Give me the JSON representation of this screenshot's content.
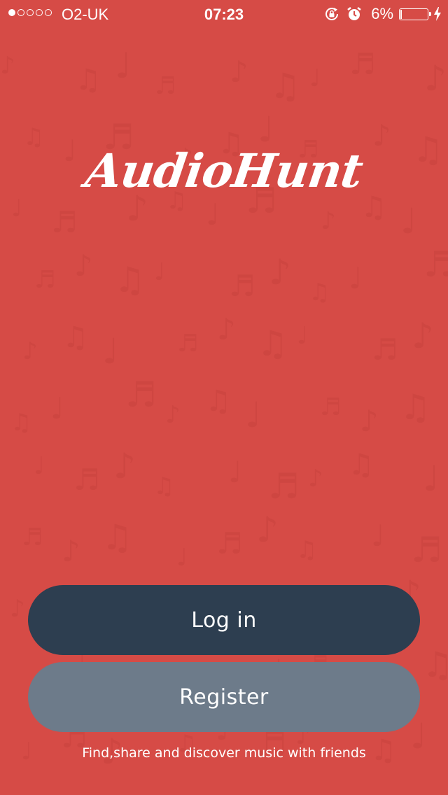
{
  "colors": {
    "background": "#d64b46",
    "login_button": "#2d3e50",
    "register_button": "#6d7b8a",
    "text": "#ffffff"
  },
  "status_bar": {
    "signal_filled": 1,
    "signal_total": 5,
    "carrier": "O2-UK",
    "time": "07:23",
    "battery_percent": "6%",
    "battery_level": 0.06,
    "icons": [
      "rotation-lock-icon",
      "alarm-icon",
      "battery-icon",
      "charging-bolt-icon"
    ]
  },
  "logo": {
    "text": "AudioHunt"
  },
  "buttons": {
    "login_label": "Log in",
    "register_label": "Register"
  },
  "tagline": "Find,share and discover music with friends"
}
